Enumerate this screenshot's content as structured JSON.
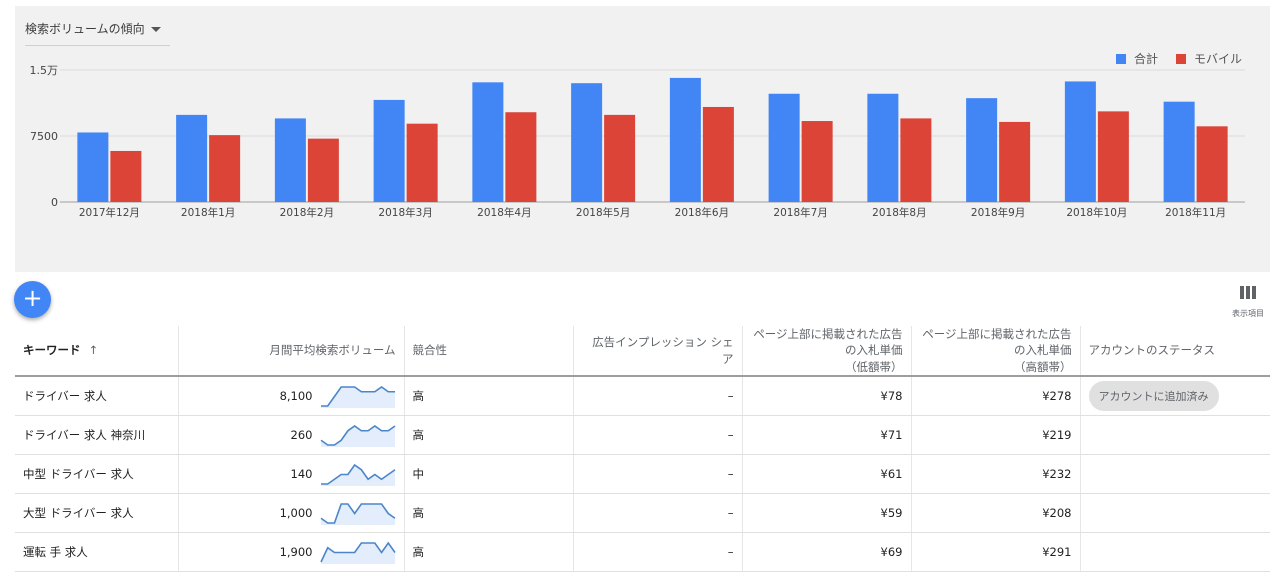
{
  "chart": {
    "title": "検索ボリュームの傾向",
    "legend": [
      {
        "label": "合計",
        "color": "#4285f4"
      },
      {
        "label": "モバイル",
        "color": "#db4437"
      }
    ]
  },
  "chart_data": {
    "type": "bar",
    "categories": [
      "2017年12月",
      "2018年1月",
      "2018年2月",
      "2018年3月",
      "2018年4月",
      "2018年5月",
      "2018年6月",
      "2018年7月",
      "2018年8月",
      "2018年9月",
      "2018年10月",
      "2018年11月"
    ],
    "series": [
      {
        "name": "合計",
        "color": "#4285f4",
        "values": [
          7900,
          9900,
          9500,
          11600,
          13600,
          13500,
          14100,
          12300,
          12300,
          11800,
          13700,
          11400
        ]
      },
      {
        "name": "モバイル",
        "color": "#db4437",
        "values": [
          5800,
          7600,
          7200,
          8900,
          10200,
          9900,
          10800,
          9200,
          9500,
          9100,
          10300,
          8600
        ]
      }
    ],
    "yticks": [
      {
        "value": 0,
        "label": "0"
      },
      {
        "value": 7500,
        "label": "7500"
      },
      {
        "value": 15000,
        "label": "1.5万"
      }
    ],
    "ylim": [
      0,
      15000
    ],
    "grid": true,
    "legend_position": "top-right"
  },
  "toolbar": {
    "fab_label": "+",
    "columns_label": "表示項目"
  },
  "table": {
    "headers": {
      "keyword": "キーワード",
      "sort_arrow": "↑",
      "volume": "月間平均検索ボリューム",
      "competition": "競合性",
      "impression_share": "広告インプレッション シェア",
      "bid_low_1": "ページ上部に掲載された広告の入札単価",
      "bid_low_2": "（低額帯）",
      "bid_high_1": "ページ上部に掲載された広告の入札単価",
      "bid_high_2": "（高額帯）",
      "status": "アカウントのステータス"
    },
    "rows": [
      {
        "keyword": "ドライバー 求人",
        "volume": "8,100",
        "trend": [
          1,
          1,
          3,
          5,
          5,
          5,
          4,
          4,
          4,
          5,
          4,
          4
        ],
        "competition": "高",
        "share": "–",
        "bid_low": "¥78",
        "bid_high": "¥278",
        "status": "アカウントに追加済み"
      },
      {
        "keyword": "ドライバー 求人 神奈川",
        "volume": "260",
        "trend": [
          2,
          1,
          1,
          2,
          4,
          5,
          4,
          4,
          5,
          4,
          4,
          5
        ],
        "competition": "高",
        "share": "–",
        "bid_low": "¥71",
        "bid_high": "¥219",
        "status": ""
      },
      {
        "keyword": "中型 ドライバー 求人",
        "volume": "140",
        "trend": [
          1,
          1,
          2,
          3,
          3,
          5,
          4,
          2,
          3,
          2,
          3,
          4
        ],
        "competition": "中",
        "share": "–",
        "bid_low": "¥61",
        "bid_high": "¥232",
        "status": ""
      },
      {
        "keyword": "大型 ドライバー 求人",
        "volume": "1,000",
        "trend": [
          2,
          1,
          1,
          5,
          5,
          3,
          5,
          5,
          5,
          5,
          3,
          2
        ],
        "competition": "高",
        "share": "–",
        "bid_low": "¥59",
        "bid_high": "¥208",
        "status": ""
      },
      {
        "keyword": "運転 手 求人",
        "volume": "1,900",
        "trend": [
          1,
          4,
          3,
          3,
          3,
          3,
          5,
          5,
          5,
          3,
          5,
          3
        ],
        "competition": "高",
        "share": "–",
        "bid_low": "¥69",
        "bid_high": "¥291",
        "status": ""
      }
    ]
  }
}
